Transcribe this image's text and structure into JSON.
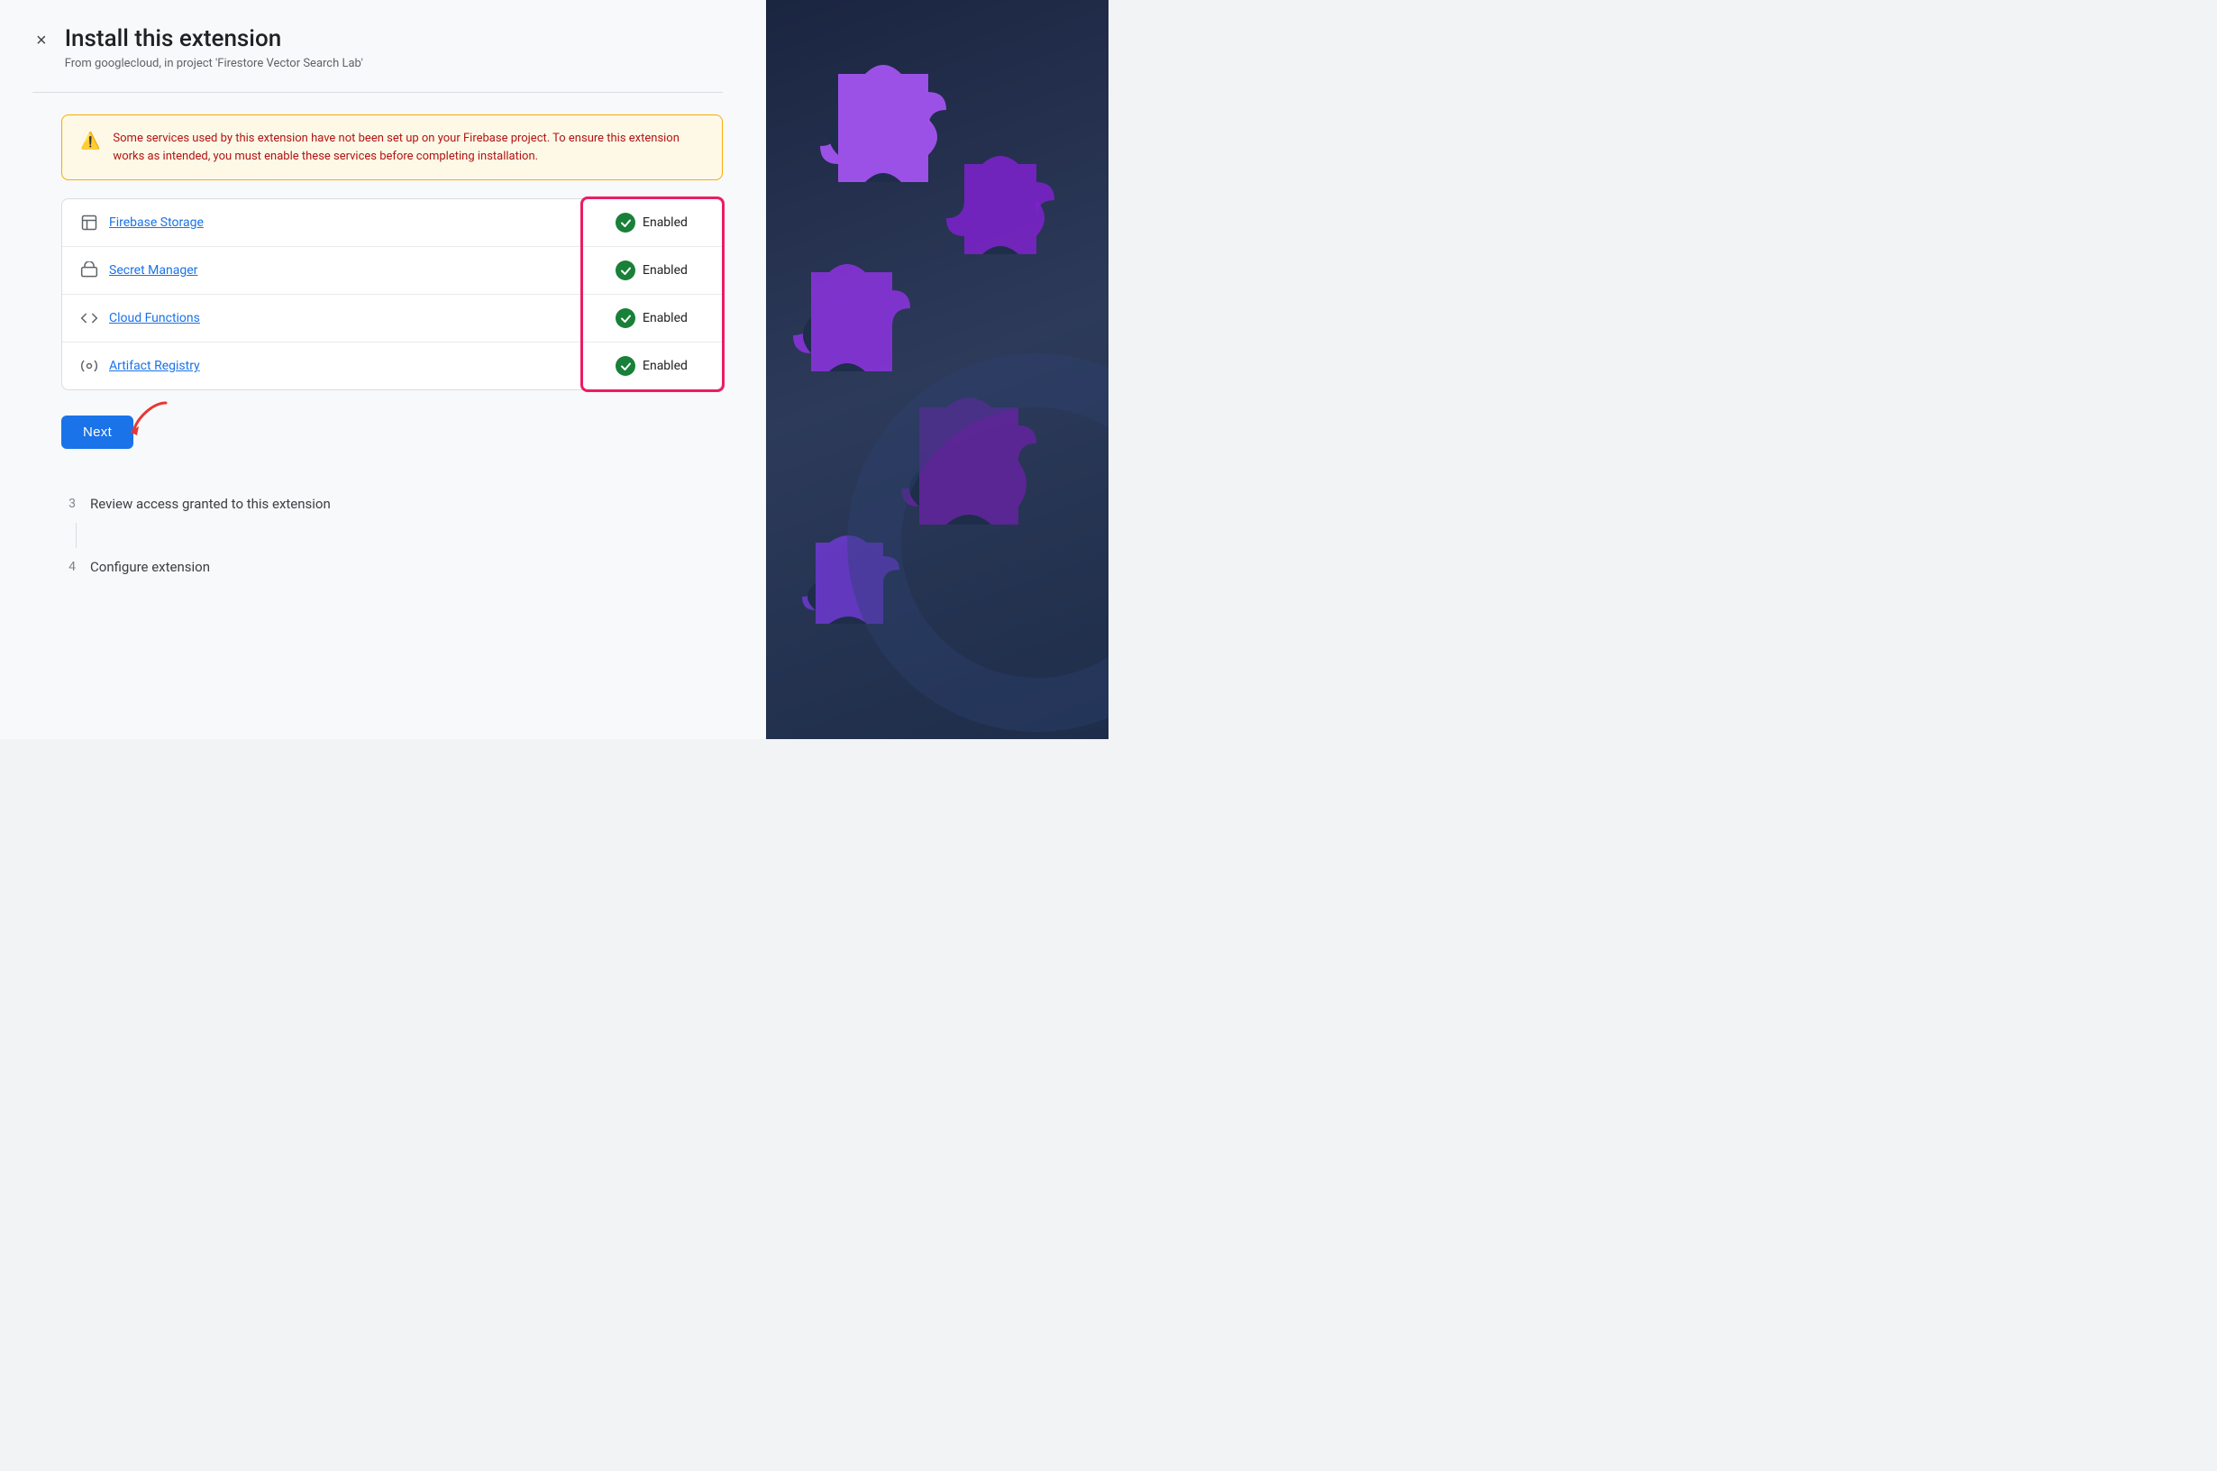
{
  "header": {
    "title": "Install this extension",
    "subtitle": "From googlecloud, in project 'Firestore Vector Search Lab'",
    "close_label": "×"
  },
  "warning": {
    "text": "Some services used by this extension have not been set up on your Firebase project. To ensure this extension works as intended, you must enable these services before completing installation."
  },
  "services": [
    {
      "name": "Firebase Storage",
      "status": "Enabled",
      "icon": "🖼"
    },
    {
      "name": "Secret Manager",
      "status": "Enabled",
      "icon": "[·]"
    },
    {
      "name": "Cloud Functions",
      "status": "Enabled",
      "icon": "{·}"
    },
    {
      "name": "Artifact Registry",
      "status": "Enabled",
      "icon": "⚙"
    }
  ],
  "next_button": {
    "label": "Next"
  },
  "steps": [
    {
      "number": "3",
      "label": "Review access granted to this extension"
    },
    {
      "number": "4",
      "label": "Configure extension"
    }
  ]
}
